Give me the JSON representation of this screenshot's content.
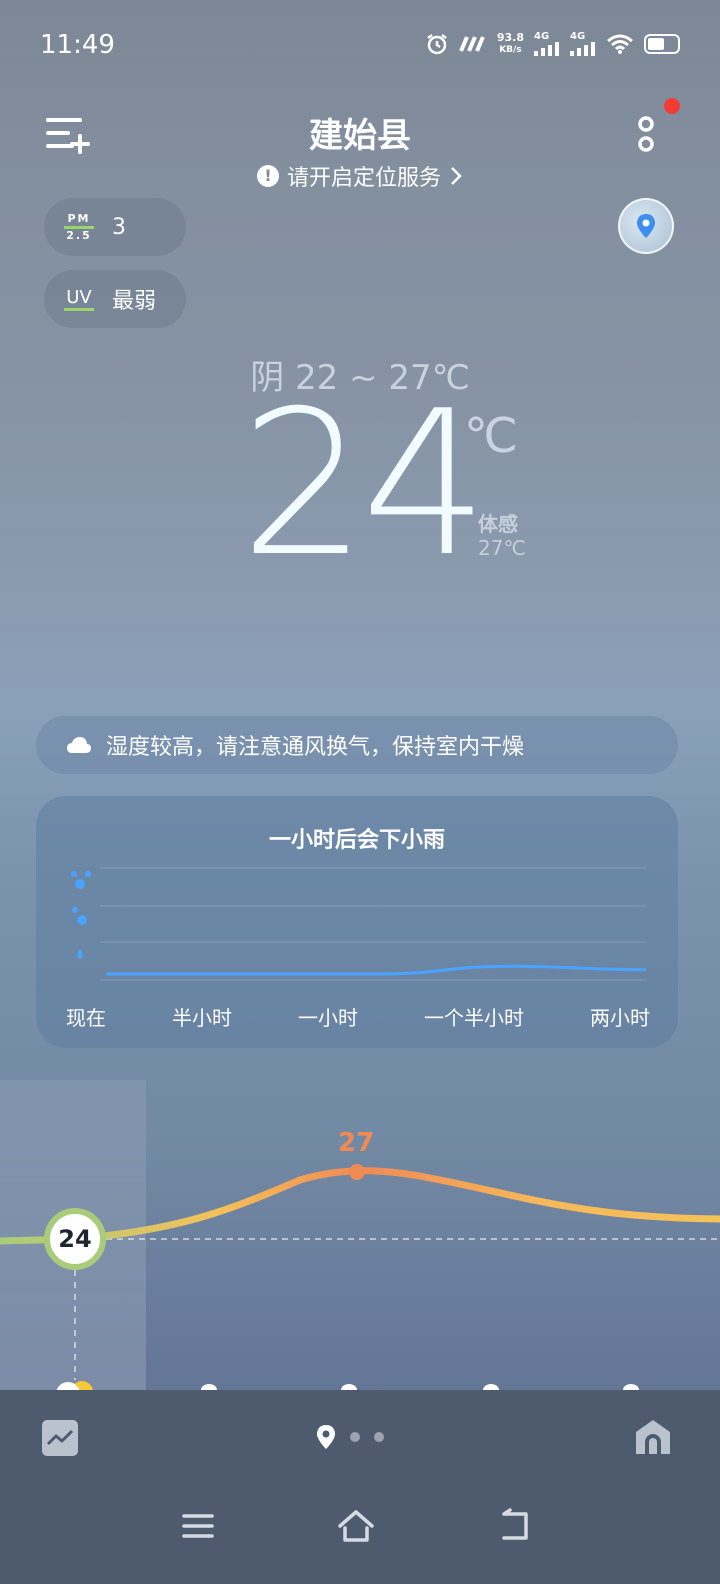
{
  "status_bar": {
    "time": "11:49",
    "net_speed_value": "93.8",
    "net_speed_unit": "KB/s",
    "signal1_label": "4G",
    "signal2_label": "4G"
  },
  "header": {
    "city": "建始县",
    "location_warning": "请开启定位服务",
    "notification_dot_color": "#f23b35"
  },
  "air": {
    "pm_label_top": "PM",
    "pm_label_bottom": "2.5",
    "pm_value": "3",
    "uv_label": "UV",
    "uv_value": "最弱",
    "accent_color": "#9bd56a"
  },
  "current": {
    "condition_range": "阴  22 ~ 27℃",
    "temperature": "24",
    "unit": "℃",
    "feels_label": "体感",
    "feels_value": "27℃"
  },
  "tip": {
    "icon": "cloud-icon",
    "text": "湿度较高，请注意通风换气，保持室内干燥"
  },
  "rain_card": {
    "title": "一小时后会下小雨",
    "axis_labels": [
      "现在",
      "半小时",
      "一小时",
      "一个半小时",
      "两小时"
    ],
    "level_icons": [
      "heavy-rain-drops-icon",
      "medium-rain-drops-icon",
      "light-rain-drop-icon"
    ],
    "line_color": "#4aa3ff"
  },
  "chart_data": {
    "type": "line",
    "title": "一小时后会下小雨",
    "x": [
      "现在",
      "半小时",
      "一小时",
      "一个半小时",
      "两小时"
    ],
    "series": [
      {
        "values": [
          0,
          0,
          0,
          0.22,
          0.12
        ]
      }
    ],
    "ylim": [
      0,
      3
    ]
  },
  "hourly": {
    "now_temp": "24",
    "peak_temp": "27",
    "line_colors": {
      "start": "#a8cc7a",
      "mid": "#f5b95a",
      "peak": "#f08a55"
    }
  },
  "bottom_bar": {
    "trend_icon": "trend-chart-icon",
    "location_icon": "location-pin-icon",
    "home_icon": "home-icon",
    "page_count": 2
  }
}
